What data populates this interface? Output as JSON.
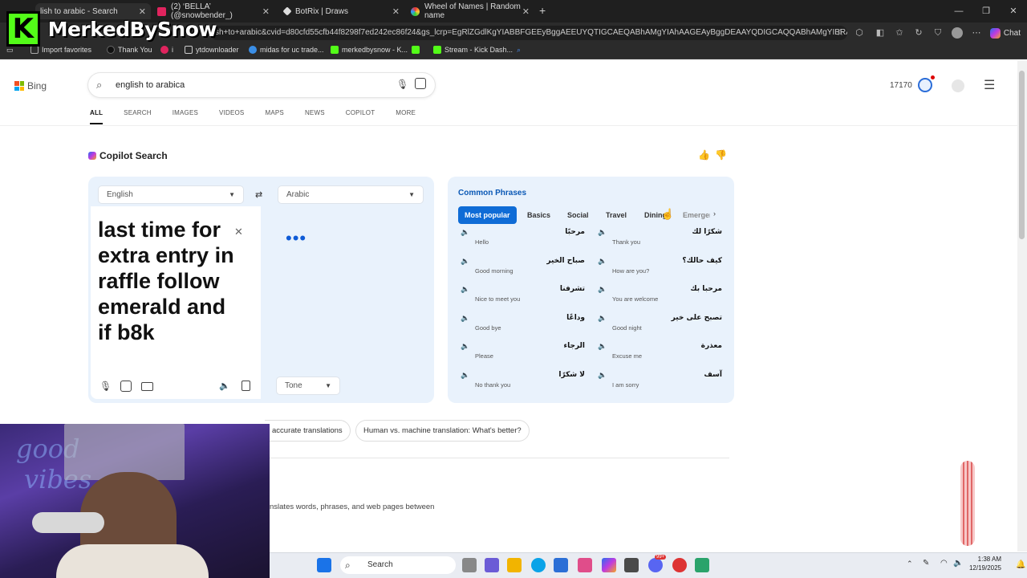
{
  "overlay": {
    "logo_letter": "K",
    "logo_text": "MerkedBySnow"
  },
  "browser": {
    "tabs": [
      {
        "title": "lish to arabic - Search",
        "active": true
      },
      {
        "title": "(2) ‘BELLA’ (@snowbender_)",
        "active": false
      },
      {
        "title": "BotRix | Draws",
        "active": false
      },
      {
        "title": "Wheel of Names | Random name",
        "active": false
      }
    ],
    "url": "sh+to+arabic&cvid=d80cfd55cfb44f8298f7ed242ec86f24&gs_lcrp=EgRlZGdlKgYIABBFGEEyBggAEEUYQTIGCAEQABhAMgYIAhAAGEAyBggDEAAYQDIGCAQQABhAMgYIBRAAGEAyBgg...",
    "chat_label": "Chat",
    "bookmarks": [
      "Import favorites",
      "Thank You",
      "i",
      "ytdownloader",
      "midas for uc trade...",
      "merkedbysnow - K...",
      "Stream - Kick Dash..."
    ]
  },
  "bing": {
    "brand": "Bing",
    "query": "english to arabica",
    "nav": [
      "ALL",
      "SEARCH",
      "IMAGES",
      "VIDEOS",
      "MAPS",
      "NEWS",
      "COPILOT",
      "MORE"
    ],
    "points": "17170",
    "copilot_title": "Copilot Search",
    "source_lang": "English",
    "target_lang": "Arabic",
    "source_text": "last time for extra entry in raffle follow emerald and if b8k",
    "loading": "•••",
    "tone_label": "Tone",
    "phrases": {
      "title": "Common Phrases",
      "tabs": [
        "Most popular",
        "Basics",
        "Social",
        "Travel",
        "Dining",
        "Emergen"
      ],
      "items": [
        {
          "ar": "مرحبًا",
          "en": "Hello"
        },
        {
          "ar": "شكرًا لك",
          "en": "Thank you"
        },
        {
          "ar": "صباح الخير",
          "en": "Good morning"
        },
        {
          "ar": "كيف حالك؟",
          "en": "How are you?"
        },
        {
          "ar": "تشرفنا",
          "en": "Nice to meet you"
        },
        {
          "ar": "مرحبا بك",
          "en": "You are welcome"
        },
        {
          "ar": "وداعًا",
          "en": "Good bye"
        },
        {
          "ar": "تصبح على خير",
          "en": "Good night"
        },
        {
          "ar": "الرجاء",
          "en": "Please"
        },
        {
          "ar": "معذرة",
          "en": "Excuse me"
        },
        {
          "ar": "لا شكرًا",
          "en": "No thank you"
        },
        {
          "ar": "آسف",
          "en": "I am sorry"
        }
      ]
    },
    "chips": [
      "accurate translations",
      "Human vs. machine translation: What's better?"
    ],
    "description": "nslates words, phrases, and web pages between"
  },
  "taskbar": {
    "search_label": "Search",
    "badge": "99+",
    "time": "1:38 AM",
    "date": "12/19/2025"
  },
  "colors": {
    "accent": "#0f6cd6",
    "panel": "#e9f2fc",
    "kick_green": "#53fc18"
  }
}
